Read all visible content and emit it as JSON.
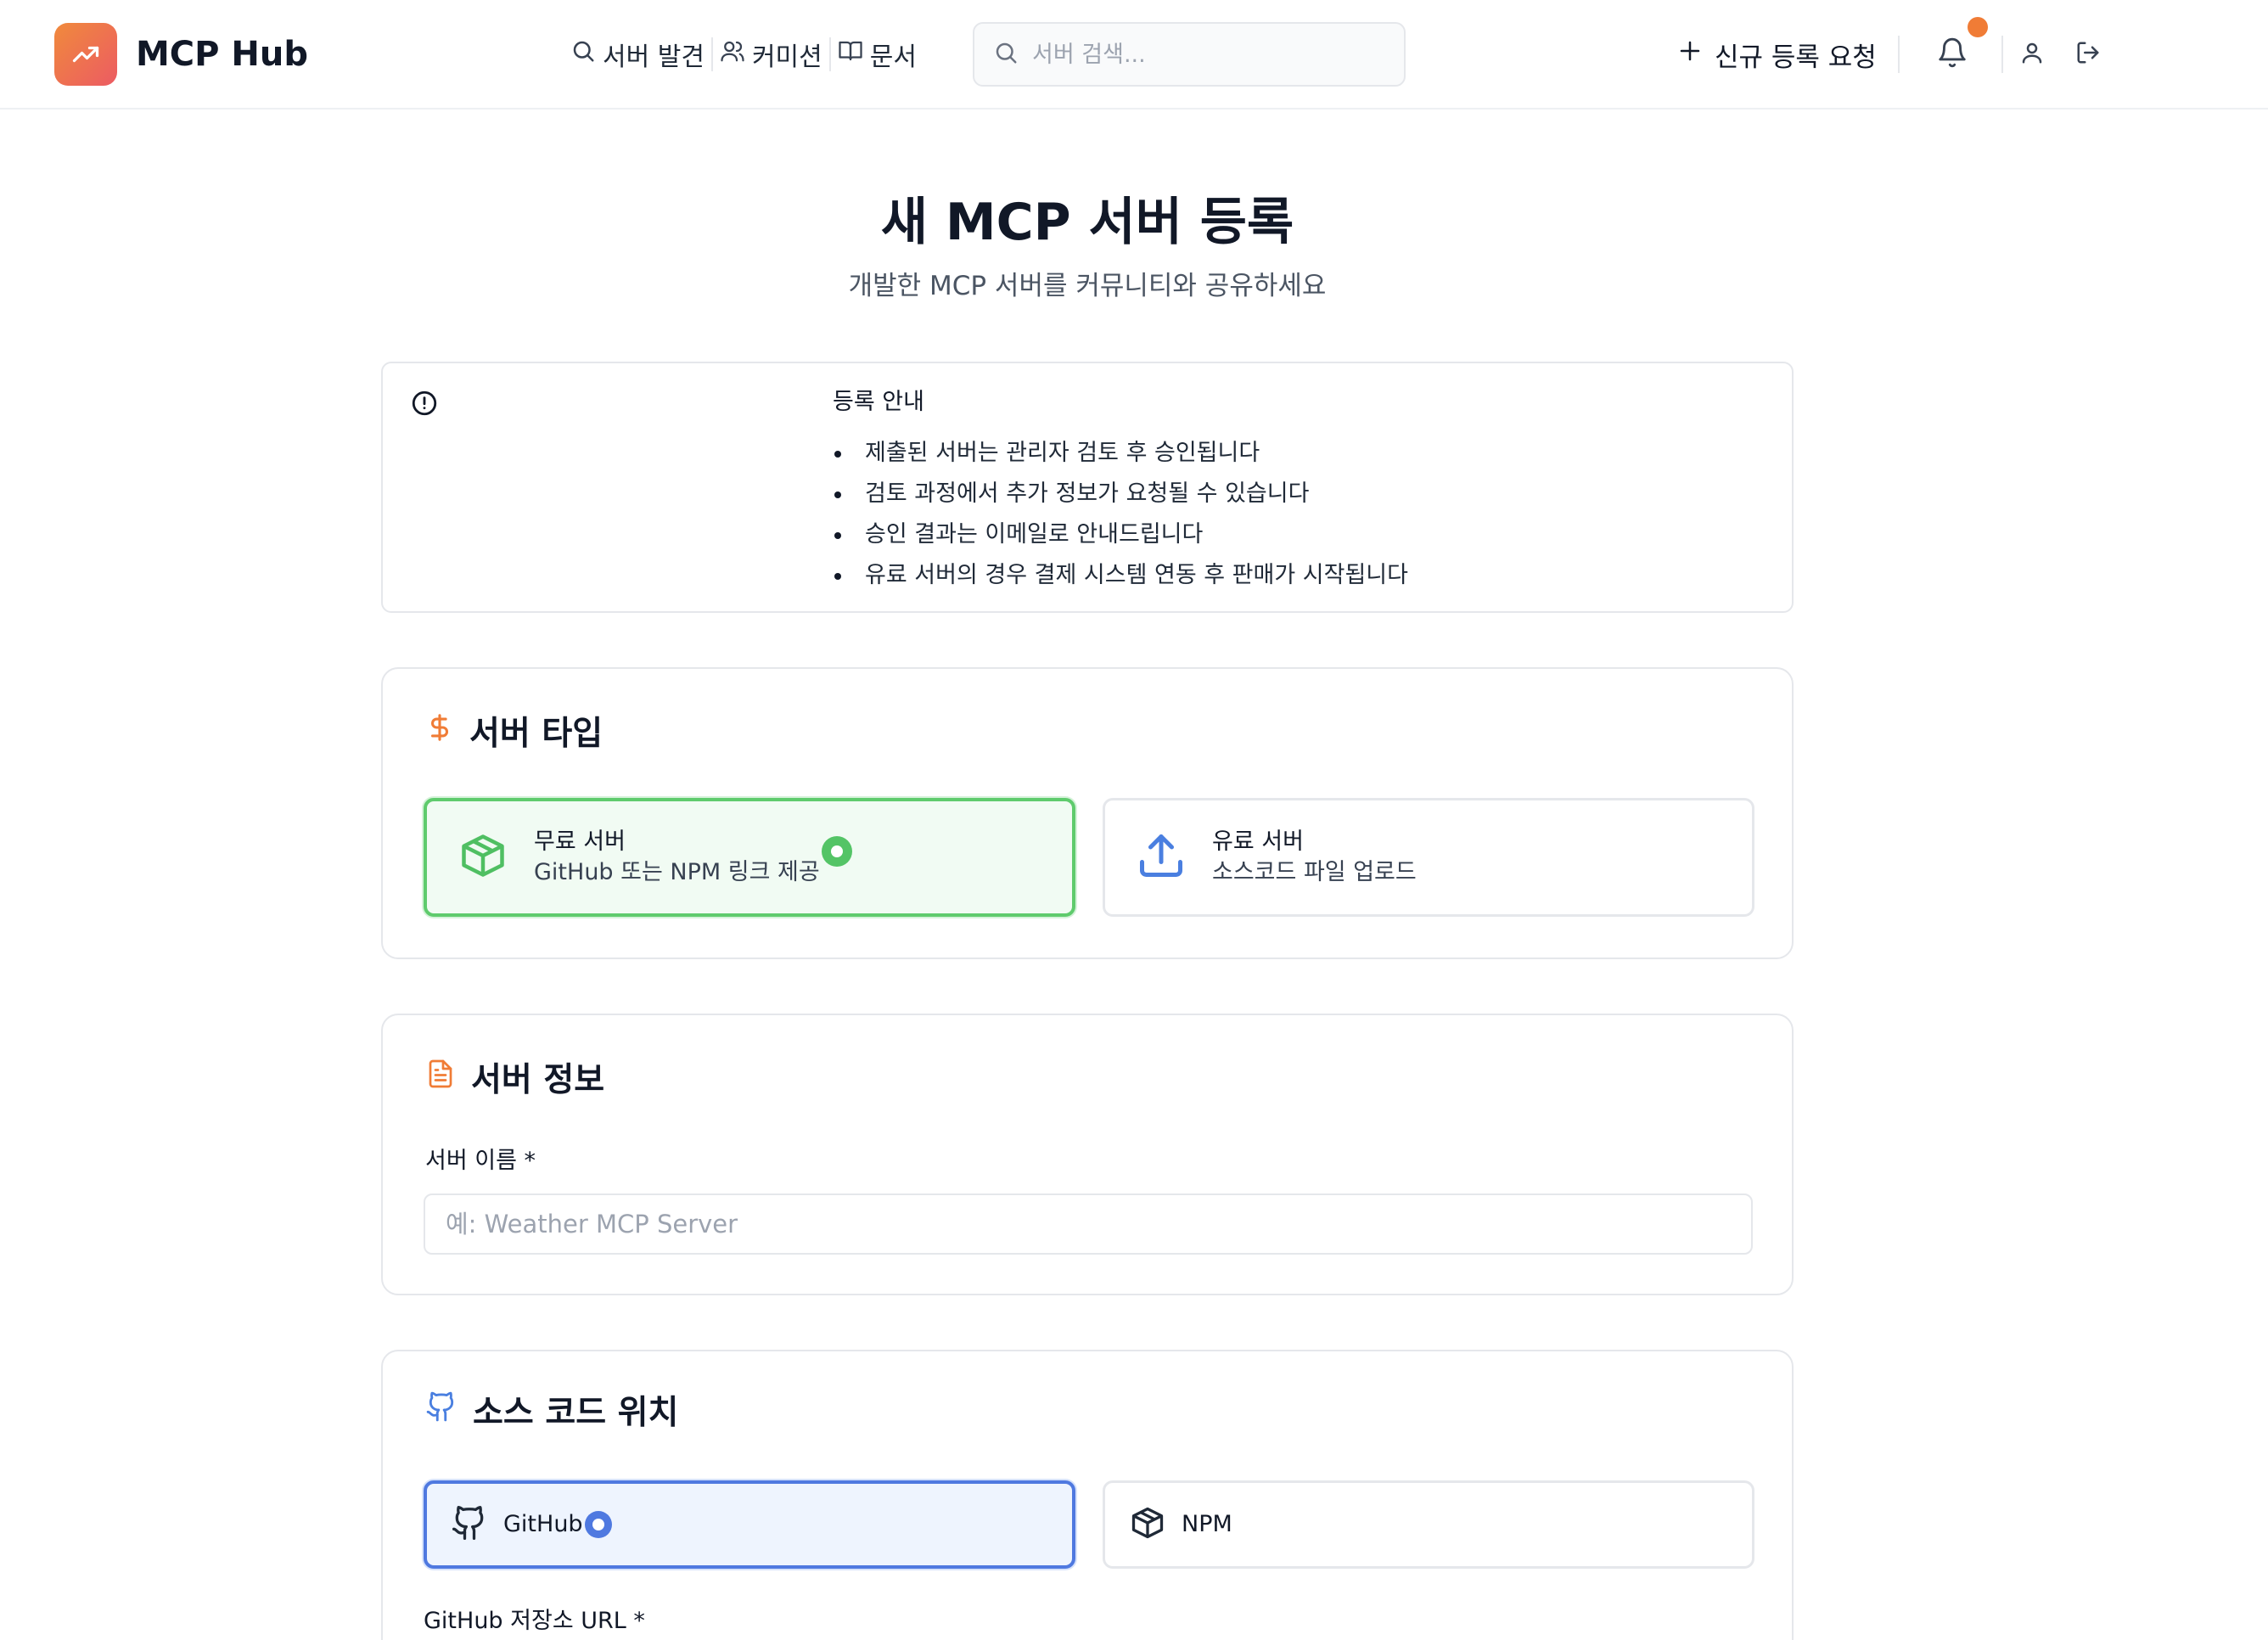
{
  "header": {
    "app_name": "MCP Hub",
    "nav": [
      {
        "label": "서버 발견",
        "icon": "search-icon"
      },
      {
        "label": "커미션",
        "icon": "users-icon"
      },
      {
        "label": "문서",
        "icon": "book-icon"
      }
    ],
    "search_placeholder": "서버 검색...",
    "request_label": "신규 등록 요청"
  },
  "page": {
    "title": "새 MCP 서버 등록",
    "subtitle": "개발한 MCP 서버를 커뮤니티와 공유하세요"
  },
  "notice": {
    "title": "등록 안내",
    "items": [
      "제출된 서버는 관리자 검토 후 승인됩니다",
      "검토 과정에서 추가 정보가 요청될 수 있습니다",
      "승인 결과는 이메일로 안내드립니다",
      "유료 서버의 경우 결제 시스템 연동 후 판매가 시작됩니다"
    ]
  },
  "server_type": {
    "heading": "서버 타입",
    "options": [
      {
        "title": "무료 서버",
        "desc": "GitHub 또는 NPM 링크 제공",
        "selected": true
      },
      {
        "title": "유료 서버",
        "desc": "소스코드 파일 업로드",
        "selected": false
      }
    ]
  },
  "server_info": {
    "heading": "서버 정보",
    "name_label": "서버 이름 *",
    "name_placeholder": "예: Weather MCP Server"
  },
  "source": {
    "heading": "소스 코드 위치",
    "options": [
      {
        "label": "GitHub",
        "selected": true
      },
      {
        "label": "NPM",
        "selected": false
      }
    ],
    "url_label": "GitHub 저장소 URL *"
  },
  "colors": {
    "accent_orange": "#f07c36",
    "selected_green": "#5fcb6d",
    "selected_blue": "#4f79e0"
  }
}
